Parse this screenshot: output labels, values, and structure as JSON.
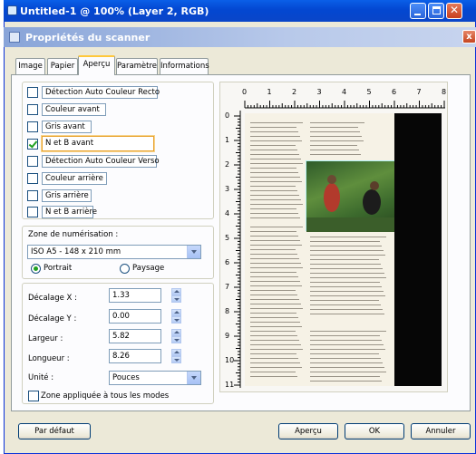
{
  "window": {
    "title": "Untitled-1 @ 100% (Layer 2, RGB)"
  },
  "dialog": {
    "title": "Propriétés du scanner",
    "close": "x"
  },
  "tabs": [
    {
      "label": "Image"
    },
    {
      "label": "Papier"
    },
    {
      "label": "Aperçu"
    },
    {
      "label": "Paramètre"
    },
    {
      "label": "Informations"
    }
  ],
  "scan_options": [
    {
      "label": "Détection Auto Couleur Recto",
      "checked": false
    },
    {
      "label": "Couleur avant",
      "checked": false
    },
    {
      "label": "Gris avant",
      "checked": false
    },
    {
      "label": "N et B avant",
      "checked": true
    },
    {
      "label": "Détection Auto Couleur Verso",
      "checked": false
    },
    {
      "label": "Couleur arrière",
      "checked": false
    },
    {
      "label": "Gris arrière",
      "checked": false
    },
    {
      "label": "N et B arrière",
      "checked": false
    }
  ],
  "zone": {
    "label": "Zone de numérisation :",
    "value": "ISO A5 - 148 x 210 mm",
    "portrait": "Portrait",
    "paysage": "Paysage"
  },
  "fields": {
    "decalage_x": {
      "label": "Décalage X :",
      "value": "1.33"
    },
    "decalage_y": {
      "label": "Décalage Y :",
      "value": "0.00"
    },
    "largeur": {
      "label": "Largeur :",
      "value": "5.82"
    },
    "longueur": {
      "label": "Longueur :",
      "value": "8.26"
    },
    "unite": {
      "label": "Unité :",
      "value": "Pouces"
    },
    "zone_all": "Zone appliquée à tous les modes"
  },
  "ruler": {
    "top": [
      "0",
      "1",
      "2",
      "3",
      "4",
      "5",
      "6",
      "7",
      "8"
    ],
    "left": [
      "0",
      "1",
      "2",
      "3",
      "4",
      "5",
      "6",
      "7",
      "8",
      "9",
      "10",
      "11"
    ]
  },
  "buttons": {
    "default": "Par défaut",
    "apercu": "Aperçu",
    "ok": "OK",
    "annuler": "Annuler"
  }
}
